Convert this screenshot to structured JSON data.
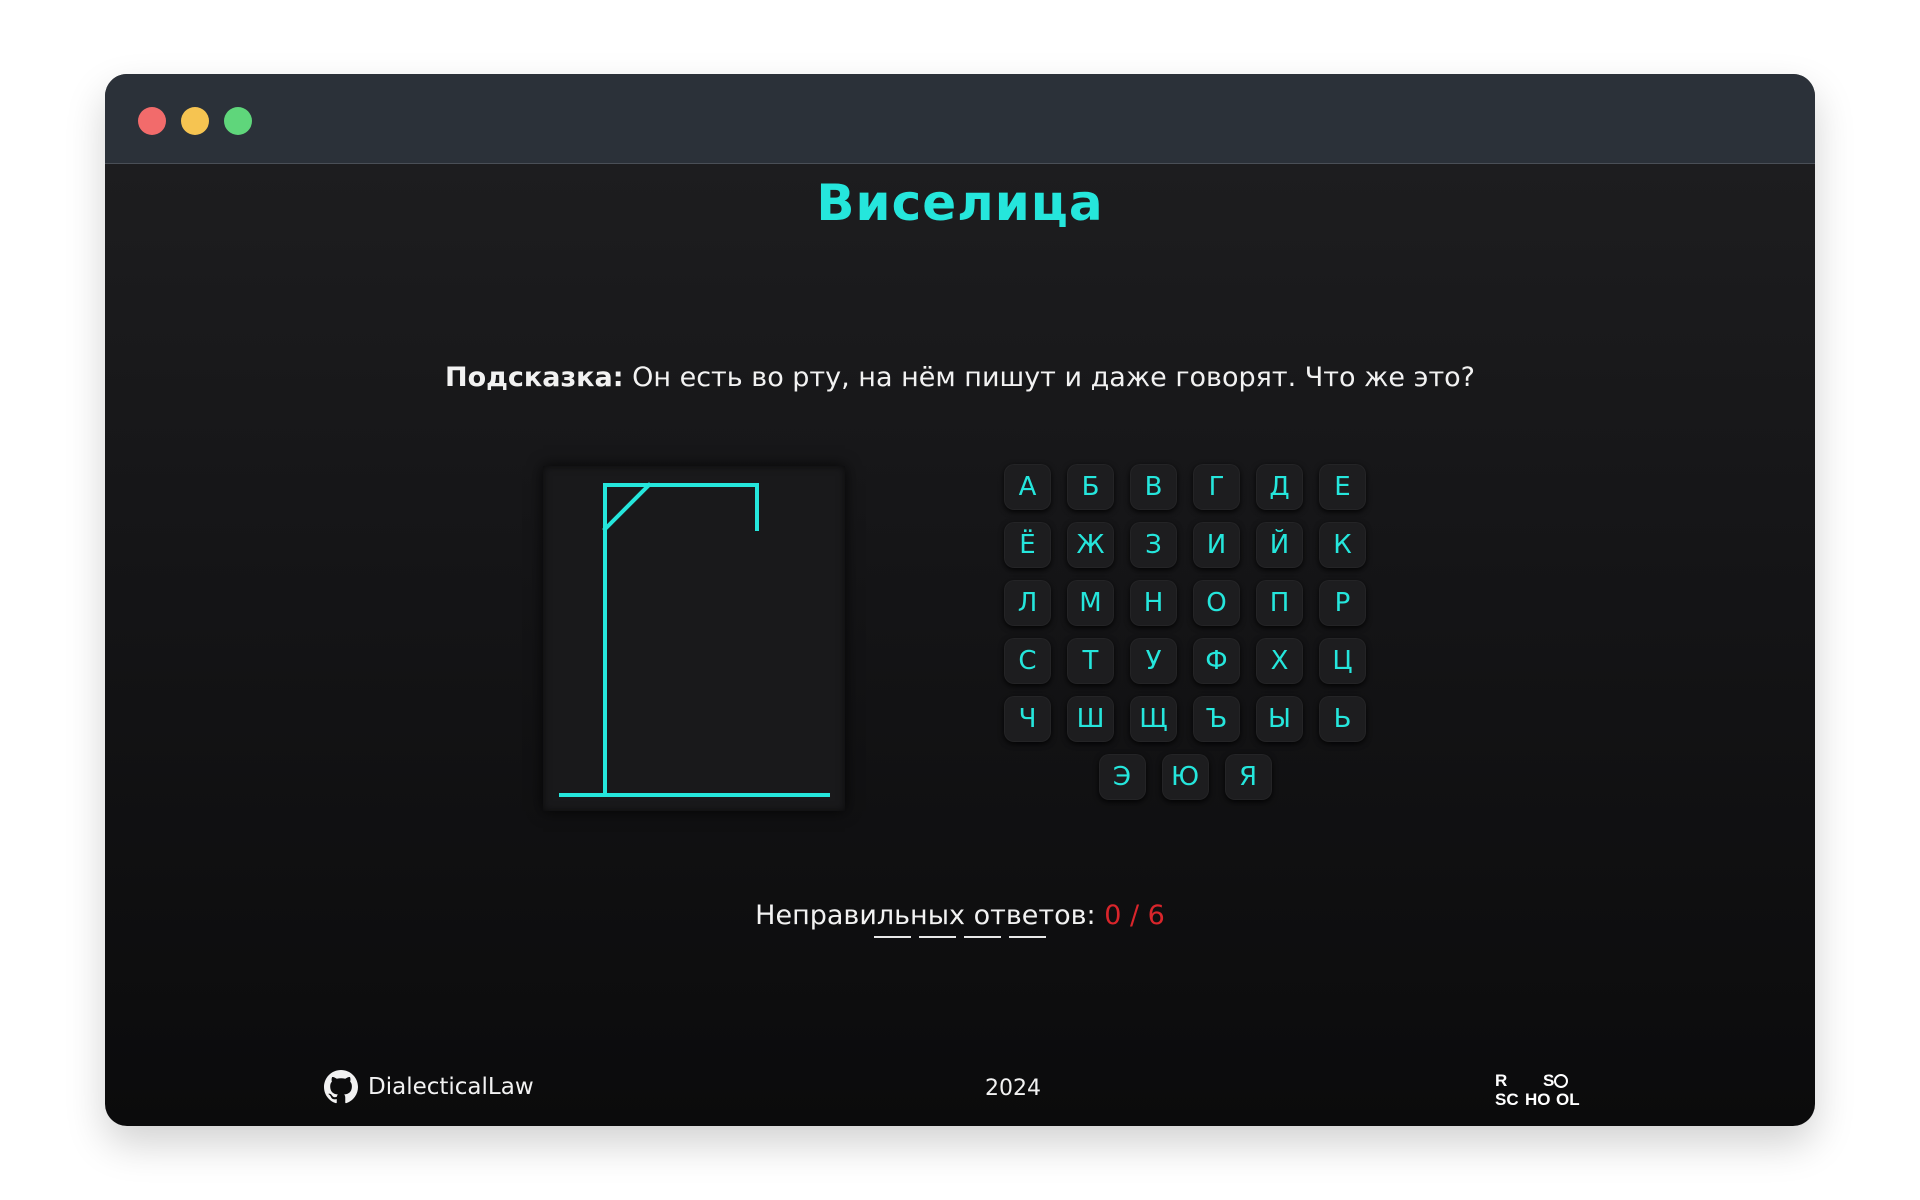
{
  "window": {
    "controls": {
      "close_color": "#f26b6b",
      "minimize_color": "#f6c451",
      "maximize_color": "#5fd67b"
    }
  },
  "colors": {
    "accent": "#25e6dc",
    "error": "#d9252b",
    "text": "#f2f2f2"
  },
  "header": {
    "title": "Виселица"
  },
  "hint": {
    "label": "Подсказка:",
    "text": "Он есть во рту, на нём пишут и даже говорят. Что же это?"
  },
  "gallows": {
    "stage": 0,
    "max_stage": 6
  },
  "keyboard": {
    "rows": [
      [
        "А",
        "Б",
        "В",
        "Г",
        "Д",
        "Е"
      ],
      [
        "Ё",
        "Ж",
        "З",
        "И",
        "Й",
        "К"
      ],
      [
        "Л",
        "М",
        "Н",
        "О",
        "П",
        "Р"
      ],
      [
        "С",
        "Т",
        "У",
        "Ф",
        "Х",
        "Ц"
      ],
      [
        "Ч",
        "Ш",
        "Щ",
        "Ъ",
        "Ы",
        "Ь"
      ],
      [
        "Э",
        "Ю",
        "Я"
      ]
    ]
  },
  "word": {
    "blank_count": 4
  },
  "score": {
    "label": "Неправильных ответов:",
    "value": "0 / 6"
  },
  "footer": {
    "github_icon": "github-icon",
    "author": "DialecticalLaw",
    "year": "2024",
    "school_logo": {
      "icon": "rs-school-logo",
      "letters": [
        "R",
        "S",
        "SC",
        "HO",
        "OL"
      ]
    }
  }
}
